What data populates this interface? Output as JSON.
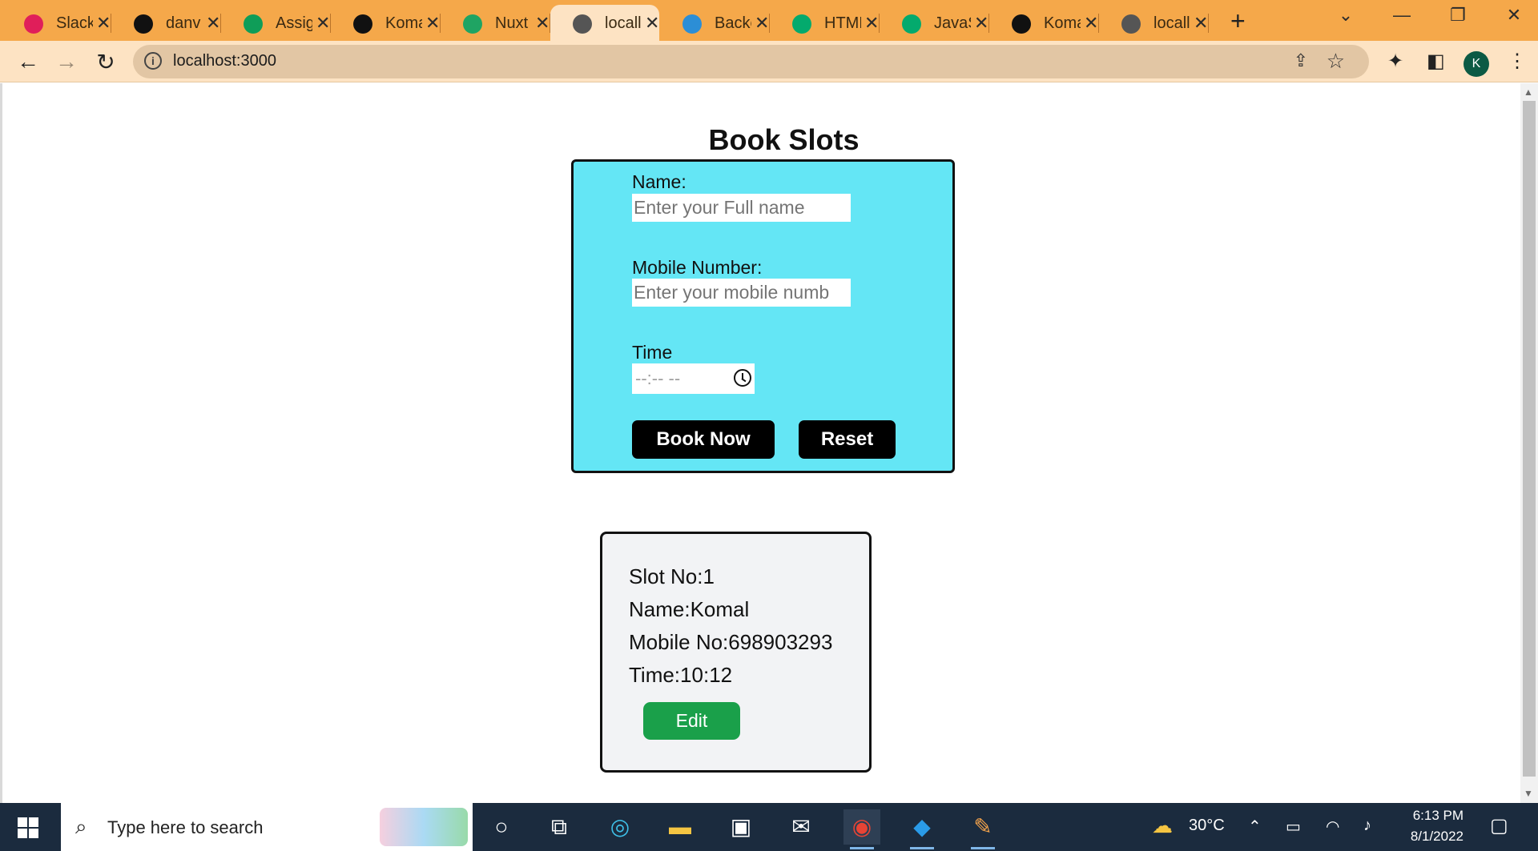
{
  "browser": {
    "tabs": [
      {
        "label": "Slack",
        "icon": "slack-icon",
        "color": "#e01e5a"
      },
      {
        "label": "danv",
        "icon": "github-icon",
        "color": "#111111"
      },
      {
        "label": "Assig",
        "icon": "google-sheets-icon",
        "color": "#0f9d58"
      },
      {
        "label": "Koma",
        "icon": "github-icon",
        "color": "#111111"
      },
      {
        "label": "Nuxt",
        "icon": "google-drive-icon",
        "color": "#1fa463"
      },
      {
        "label": "locall",
        "icon": "globe-icon",
        "color": "#555555",
        "active": true
      },
      {
        "label": "Backe",
        "icon": "backend-icon",
        "color": "#2c8ed6"
      },
      {
        "label": "HTML",
        "icon": "w3schools-icon",
        "color": "#04aa6d"
      },
      {
        "label": "JavaS",
        "icon": "w3schools-icon",
        "color": "#04aa6d"
      },
      {
        "label": "Koma",
        "icon": "github-icon",
        "color": "#111111"
      },
      {
        "label": "locall",
        "icon": "globe-icon",
        "color": "#555555"
      }
    ],
    "new_tab": "+",
    "address": "localhost:3000",
    "profile_initial": "K"
  },
  "page": {
    "title": "Book Slots",
    "form": {
      "name_label": "Name:",
      "name_placeholder": "Enter your Full name",
      "mobile_label": "Mobile Number:",
      "mobile_placeholder": "Enter your mobile numb",
      "time_label": "Time",
      "time_placeholder": "--:-- --",
      "book_button": "Book Now",
      "reset_button": "Reset"
    },
    "slot": {
      "slot_label": "Slot No:",
      "slot_value": "1",
      "name_label": "Name:",
      "name_value": "Komal",
      "mobile_label": "Mobile No:",
      "mobile_value": "698903293",
      "time_label": "Time:",
      "time_value": "10:12",
      "edit_button": "Edit"
    }
  },
  "taskbar": {
    "search_placeholder": "Type here to search",
    "weather": "30°C",
    "time": "6:13 PM",
    "date": "8/1/2022"
  },
  "colors": {
    "form_bg": "#64e6f5",
    "edit_button": "#1aa04a",
    "browser_frame": "#f5a84a"
  }
}
